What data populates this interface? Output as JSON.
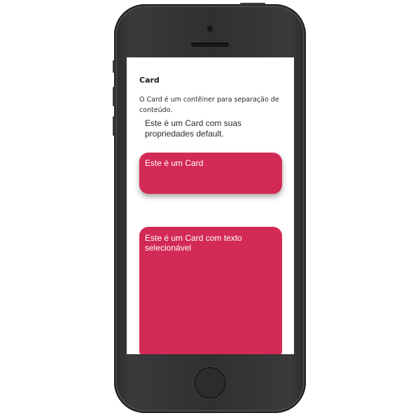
{
  "screen": {
    "title": "Card",
    "description": "O Card é um contêiner para separação de conteúdo.",
    "default_card_text": "Este é um Card com suas propriedades default.",
    "shadow_card_text": "Este é um Card",
    "selectable_card_text": "Este é um Card com texto selecionável"
  },
  "colors": {
    "card_background": "#d32a55",
    "device_body": "#303032",
    "screen_background": "#ffffff"
  }
}
